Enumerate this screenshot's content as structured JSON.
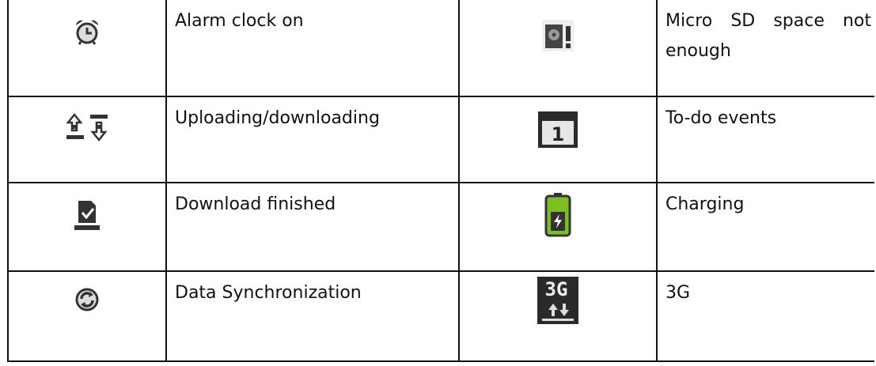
{
  "table": {
    "rows": [
      {
        "left": {
          "icon": "alarm-clock-icon",
          "label": "Alarm clock on"
        },
        "right": {
          "icon": "sd-card-warning-icon",
          "label": "Micro SD space not enough"
        }
      },
      {
        "left": {
          "icon": "upload-download-icon",
          "label": "Uploading/downloading"
        },
        "right": {
          "icon": "calendar-icon",
          "label": "To-do events",
          "icon_text": "1"
        }
      },
      {
        "left": {
          "icon": "download-finished-icon",
          "label": "Download finished"
        },
        "right": {
          "icon": "battery-charging-icon",
          "label": "Charging"
        }
      },
      {
        "left": {
          "icon": "sync-icon",
          "label": "Data Synchronization"
        },
        "right": {
          "icon": "3g-network-icon",
          "label": "3G",
          "icon_text": "3G"
        }
      }
    ]
  },
  "colors": {
    "border": "#111111",
    "icon_dark": "#2b2b2b",
    "battery_green": "#7cc020",
    "text": "#111111"
  }
}
